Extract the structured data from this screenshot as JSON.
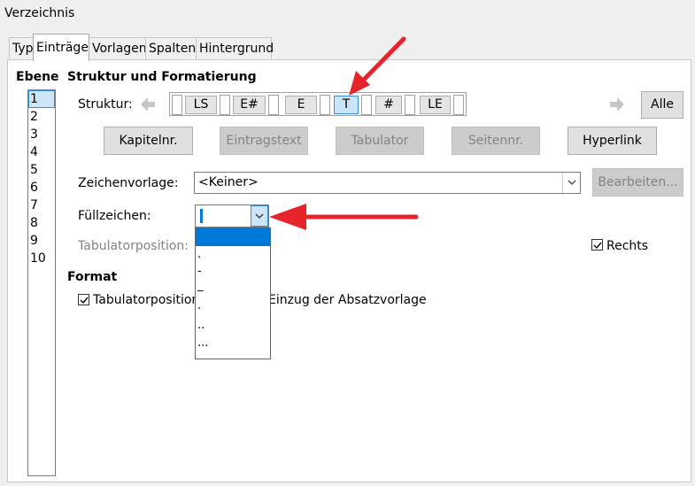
{
  "window": {
    "title": "Verzeichnis"
  },
  "tabs": [
    {
      "label": "Typ"
    },
    {
      "label": "Einträge",
      "active": true
    },
    {
      "label": "Vorlagen"
    },
    {
      "label": "Spalten"
    },
    {
      "label": "Hintergrund"
    }
  ],
  "levels": {
    "heading": "Ebene",
    "items": [
      "1",
      "2",
      "3",
      "4",
      "5",
      "6",
      "7",
      "8",
      "9",
      "10"
    ],
    "selected": "1"
  },
  "structure": {
    "section_title": "Struktur und Formatierung",
    "label": "Struktur:",
    "tokens": [
      "LS",
      "E#",
      "E",
      "T",
      "#",
      "LE"
    ],
    "selected_token": "T",
    "all_button": "Alle"
  },
  "insert_buttons": [
    {
      "label": "Kapitelnr.",
      "enabled": true
    },
    {
      "label": "Eintragstext",
      "enabled": false
    },
    {
      "label": "Tabulator",
      "enabled": false
    },
    {
      "label": "Seitennr.",
      "enabled": false
    },
    {
      "label": "Hyperlink",
      "enabled": true
    }
  ],
  "char_style": {
    "label": "Zeichenvorlage:",
    "value": "<Keiner>",
    "edit_button": "Bearbeiten..."
  },
  "fill_char": {
    "label": "Füllzeichen:",
    "value": "",
    "options": [
      "",
      ".",
      "-",
      "_",
      "·",
      "..",
      "..."
    ],
    "selected_index": 0
  },
  "tab_position": {
    "label": "Tabulatorposition:",
    "right_label": "Rechts",
    "right_checked": true
  },
  "format": {
    "section_title": "Format",
    "relative_checkbox_label_start": "Tabulatorposition",
    "relative_checkbox_label_end": "Einzug der Absatzvorlage",
    "relative_checked": true
  },
  "colors": {
    "accent": "#0078d7",
    "selection_bg": "#cce4f7",
    "annotation_arrow": "#e8242b"
  }
}
